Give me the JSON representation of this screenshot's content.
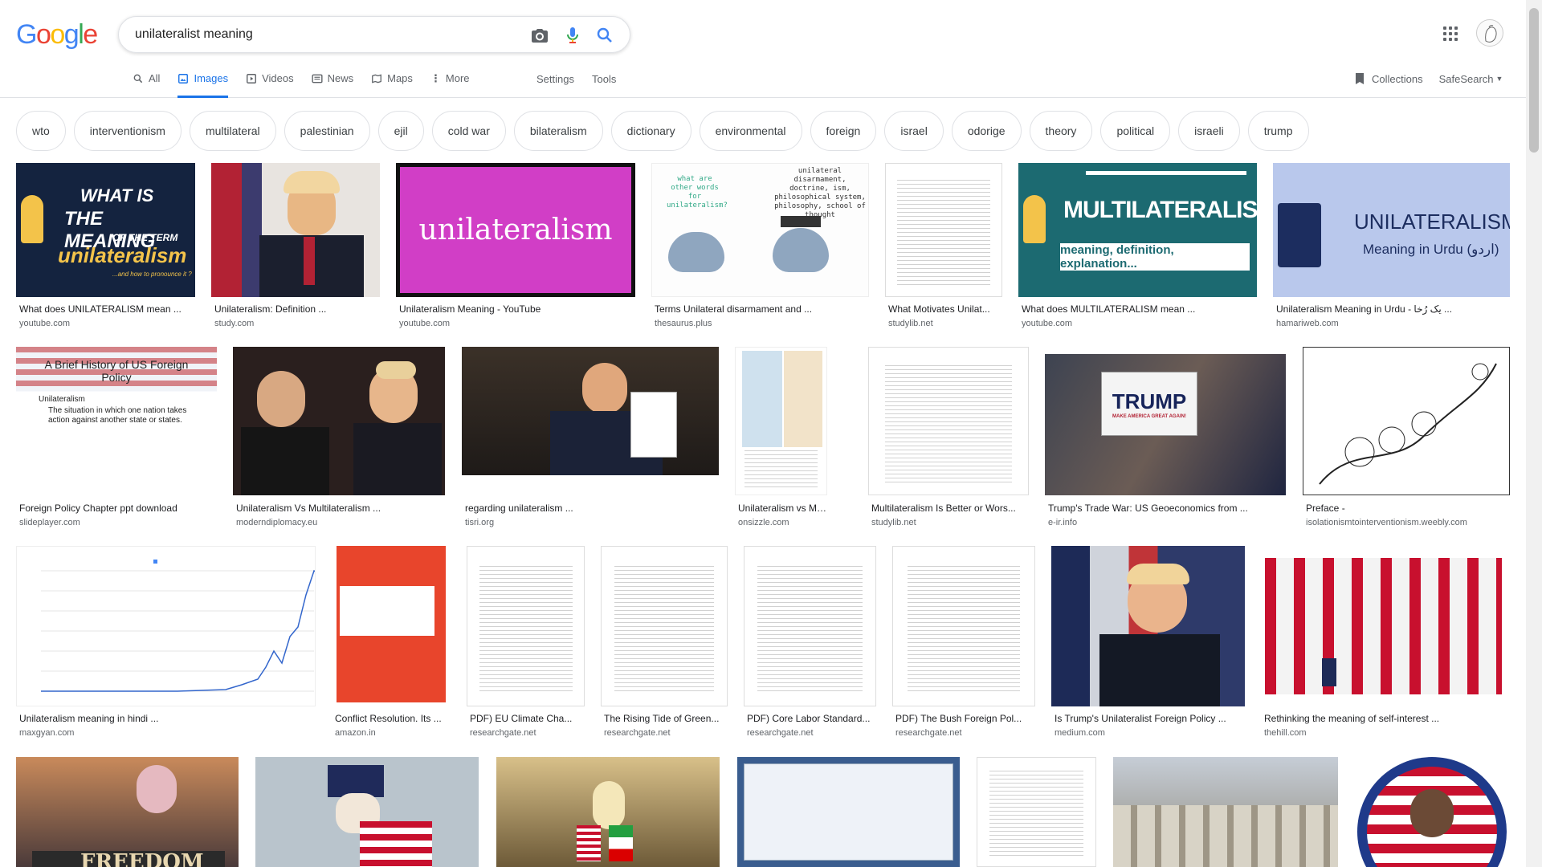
{
  "logo_text": "Google",
  "search": {
    "query": "unilateralist meaning"
  },
  "tabs": [
    "All",
    "Images",
    "Videos",
    "News",
    "Maps",
    "More"
  ],
  "tools": [
    "Settings",
    "Tools"
  ],
  "right_tools": {
    "collections": "Collections",
    "safesearch": "SafeSearch"
  },
  "chips": [
    "wto",
    "interventionism",
    "multilateral",
    "palestinian",
    "ejil",
    "cold war",
    "bilateralism",
    "dictionary",
    "environmental",
    "foreign",
    "israel",
    "odorige",
    "theory",
    "political",
    "israeli",
    "trump"
  ],
  "thumb_texts": {
    "t1_line1": "WHAT IS",
    "t1_line2": "THE MEANING",
    "t1_line3": "OF THE TERM",
    "t1_line4": "unilateralism",
    "t1_line5": "...and how to pronounce it ?",
    "t3": "unilateralism",
    "t4a": "what are other words for unilateralism?",
    "t4b": "unilateral disarmament, doctrine, ism, philosophical system, philosophy, school of thought",
    "t6a": "MULTILATERALISM",
    "t6b": "meaning, definition, explanation...",
    "t7a": "UNILATERALISM",
    "t7b": "Meaning in Urdu (اردو)",
    "t8a": "A Brief History of US Foreign Policy",
    "t8b": "Unilateralism",
    "t8c": "The situation in which one nation takes action against another state or states.",
    "t12": "TRUMP",
    "t12b": "MAKE AMERICA GREAT AGAIN!",
    "t22": "FREEDOM"
  },
  "images": [
    {
      "caption": "What does UNILATERALISM mean ...",
      "source": "youtube.com"
    },
    {
      "caption": "Unilateralism: Definition ...",
      "source": "study.com"
    },
    {
      "caption": "Unilateralism Meaning - YouTube",
      "source": "youtube.com"
    },
    {
      "caption": "Terms Unilateral disarmament and ...",
      "source": "thesaurus.plus"
    },
    {
      "caption": "What Motivates Unilat...",
      "source": "studylib.net"
    },
    {
      "caption": "What does MULTILATERALISM mean ...",
      "source": "youtube.com"
    },
    {
      "caption": "Unilateralism Meaning in Urdu - یک رُخا ...",
      "source": "hamariweb.com"
    },
    {
      "caption": "Foreign Policy Chapter ppt download",
      "source": "slideplayer.com"
    },
    {
      "caption": "Unilateralism Vs Multilateralism ...",
      "source": "moderndiplomacy.eu"
    },
    {
      "caption": "regarding unilateralism ...",
      "source": "tisri.org"
    },
    {
      "caption": "Unilateralism vs Multil...",
      "source": "onsizzle.com"
    },
    {
      "caption": "Multilateralism Is Better or Wors...",
      "source": "studylib.net"
    },
    {
      "caption": "Trump's Trade War: US Geoeconomics from ...",
      "source": "e-ir.info"
    },
    {
      "caption": "Preface -",
      "source": "isolationismtointerventionism.weebly.com"
    },
    {
      "caption": "Unilateralism meaning in hindi ...",
      "source": "maxgyan.com"
    },
    {
      "caption": "Conflict Resolution. Its ...",
      "source": "amazon.in"
    },
    {
      "caption": "PDF) EU Climate Cha...",
      "source": "researchgate.net"
    },
    {
      "caption": "The Rising Tide of Green...",
      "source": "researchgate.net"
    },
    {
      "caption": "PDF) Core Labor Standard...",
      "source": "researchgate.net"
    },
    {
      "caption": "PDF) The Bush Foreign Pol...",
      "source": "researchgate.net"
    },
    {
      "caption": "Is Trump's Unilateralist Foreign Policy ...",
      "source": "medium.com"
    },
    {
      "caption": "Rethinking the meaning of self-interest ...",
      "source": "thehill.com"
    }
  ],
  "colors": {
    "accent": "#1a73e8",
    "chip_border": "#dfe1e5",
    "source_text": "#5f6368"
  }
}
